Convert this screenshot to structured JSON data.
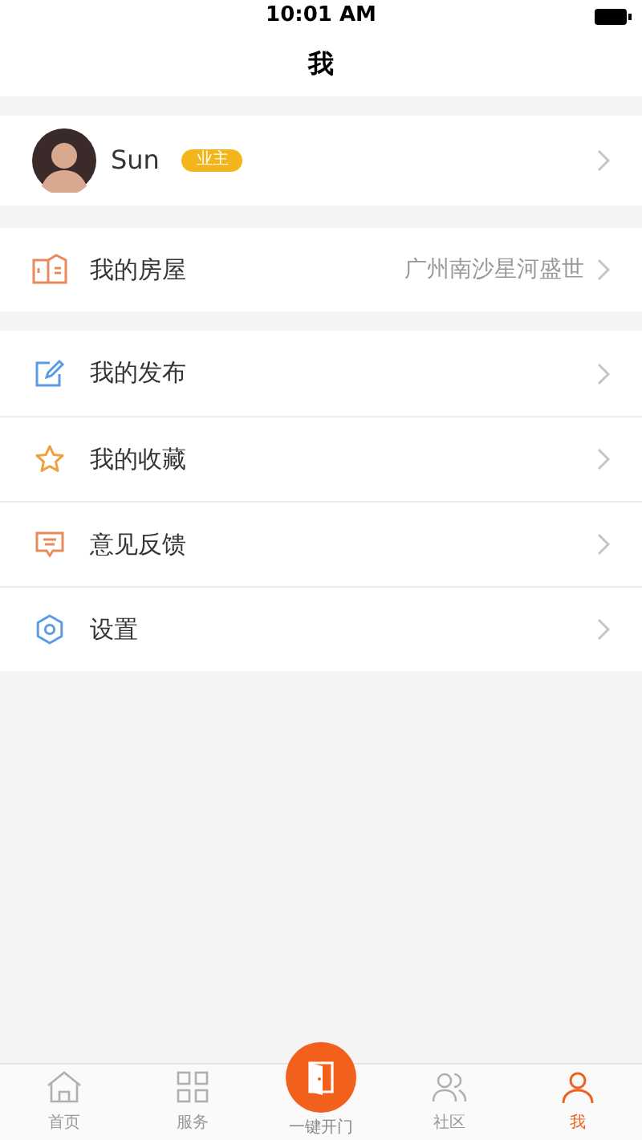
{
  "status_bar": {
    "time": "10:01 AM"
  },
  "nav": {
    "title": "我"
  },
  "profile": {
    "name": "Sun",
    "badge": "业主"
  },
  "house": {
    "label": "我的房屋",
    "value": "广州南沙星河盛世"
  },
  "menu": [
    {
      "label": "我的发布"
    },
    {
      "label": "我的收藏"
    },
    {
      "label": "意见反馈"
    },
    {
      "label": "设置"
    }
  ],
  "tab_bar": [
    {
      "kind": "tab",
      "label": "首页",
      "selected": false
    },
    {
      "kind": "tab",
      "label": "服务",
      "selected": false
    },
    {
      "kind": "action",
      "label": "一键开门",
      "selected": false
    },
    {
      "kind": "tab",
      "label": "社区",
      "selected": false
    },
    {
      "kind": "tab",
      "label": "我",
      "selected": true
    }
  ]
}
